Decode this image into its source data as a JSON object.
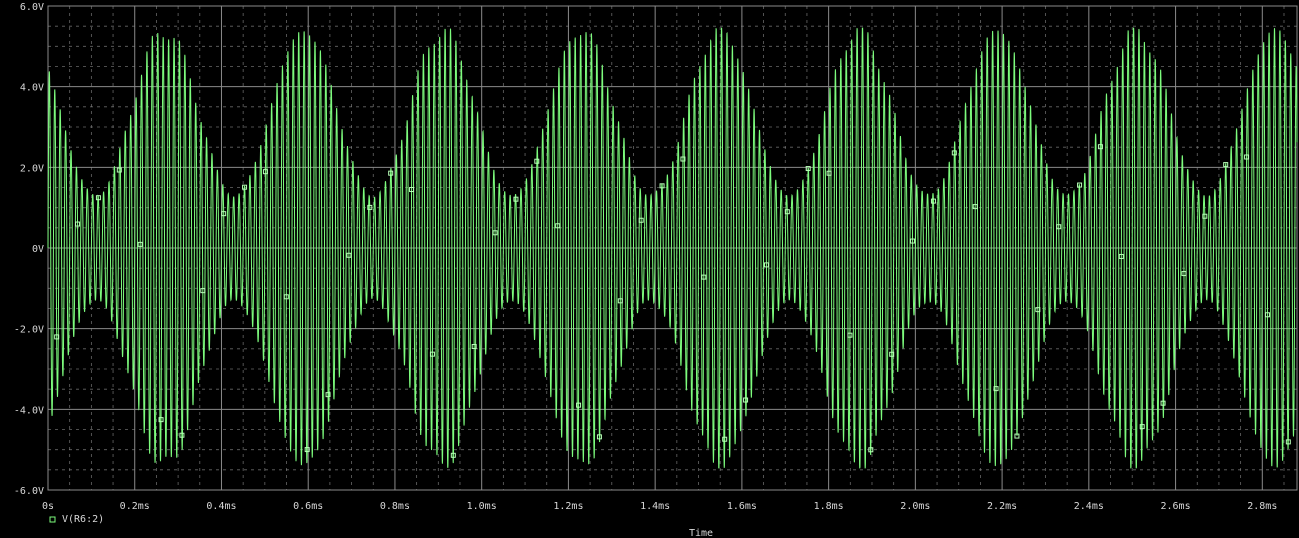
{
  "chart_data": {
    "type": "line",
    "xlabel": "Time",
    "ylabel": "",
    "xlim": [
      0,
      2.88
    ],
    "ylim": [
      -6.0,
      6.0
    ],
    "x_unit": "ms",
    "y_unit": "V",
    "x_ticks": [
      "0s",
      "0.2ms",
      "0.4ms",
      "0.6ms",
      "0.8ms",
      "1.0ms",
      "1.2ms",
      "1.4ms",
      "1.6ms",
      "1.8ms",
      "2.0ms",
      "2.2ms",
      "2.4ms",
      "2.6ms",
      "2.8ms"
    ],
    "y_ticks": [
      "6.0V",
      "4.0V",
      "2.0V",
      "0V",
      "-2.0V",
      "-4.0V",
      "-6.0V"
    ],
    "grid": true,
    "legend": [
      {
        "marker": "square",
        "label": "V(R6:2)"
      }
    ],
    "series": [
      {
        "name": "V(R6:2)",
        "description_values": {
          "carrier_frequency_khz": 80,
          "modulation_frequency_khz": 3.125,
          "envelope_peak_v": 5.4,
          "envelope_min_v": 1.3,
          "envelope_peaks_at_ms": [
            0.27,
            0.59,
            0.91,
            1.23,
            1.55,
            1.87,
            2.19,
            2.51,
            2.83
          ],
          "envelope_minima_at_ms": [
            0.11,
            0.43,
            0.75,
            1.07,
            1.39,
            1.71,
            2.03,
            2.35,
            2.67
          ]
        }
      }
    ]
  },
  "style": {
    "background": "#000000",
    "grid_color": "#8a8a8a",
    "trace_color": "#7dfc7d",
    "text_color": "#d8d8d8"
  }
}
